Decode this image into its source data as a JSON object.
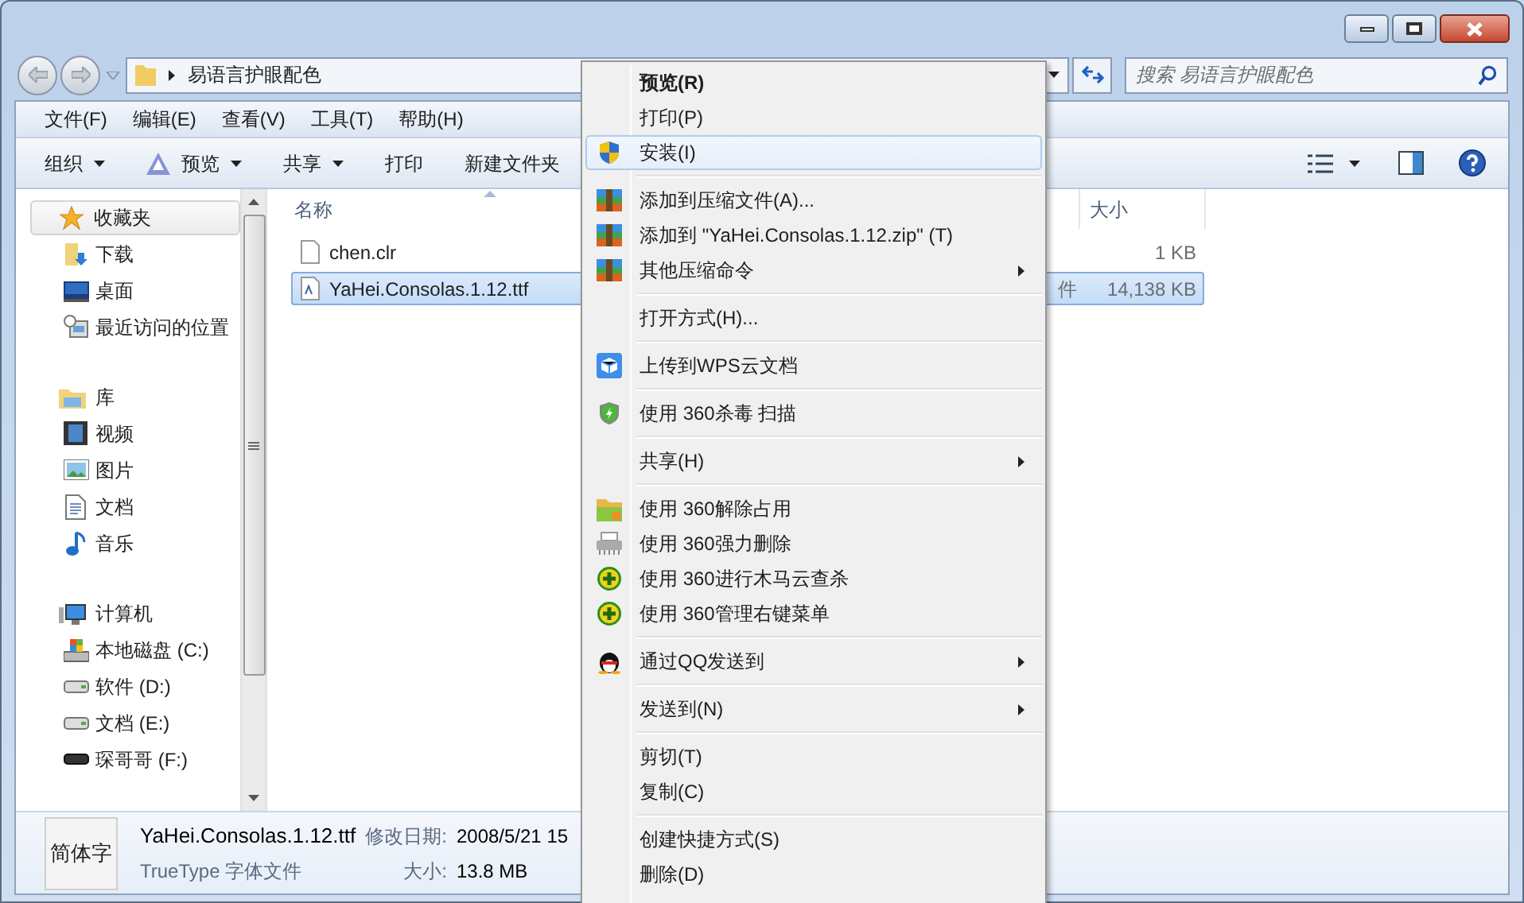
{
  "address": {
    "crumb": "易语言护眼配色"
  },
  "search": {
    "placeholder": "搜索 易语言护眼配色"
  },
  "menubar": [
    "文件(F)",
    "编辑(E)",
    "查看(V)",
    "工具(T)",
    "帮助(H)"
  ],
  "toolbar": [
    {
      "label": "组织",
      "dropdown": true,
      "icon": false
    },
    {
      "label": "预览",
      "dropdown": true,
      "icon": true
    },
    {
      "label": "共享",
      "dropdown": true,
      "icon": false
    },
    {
      "label": "打印",
      "dropdown": false,
      "icon": false
    },
    {
      "label": "新建文件夹",
      "dropdown": false,
      "icon": false
    }
  ],
  "sidebar": {
    "groups": [
      {
        "label": "收藏夹",
        "kind": "star",
        "selected": true,
        "children": [
          {
            "label": "下载",
            "kind": "download"
          },
          {
            "label": "桌面",
            "kind": "desktop"
          },
          {
            "label": "最近访问的位置",
            "kind": "recent"
          }
        ]
      },
      {
        "label": "库",
        "kind": "library",
        "selected": false,
        "children": [
          {
            "label": "视频",
            "kind": "video"
          },
          {
            "label": "图片",
            "kind": "image"
          },
          {
            "label": "文档",
            "kind": "doc"
          },
          {
            "label": "音乐",
            "kind": "music"
          }
        ]
      },
      {
        "label": "计算机",
        "kind": "computer",
        "selected": false,
        "children": [
          {
            "label": "本地磁盘 (C:)",
            "kind": "sysdrive"
          },
          {
            "label": "软件 (D:)",
            "kind": "drive"
          },
          {
            "label": "文档 (E:)",
            "kind": "drive"
          },
          {
            "label": "琛哥哥 (F:)",
            "kind": "removable"
          }
        ]
      }
    ]
  },
  "table": {
    "columns": [
      "名称",
      "大小"
    ],
    "rows": [
      {
        "name": "chen.clr",
        "size": "1 KB",
        "selected": false,
        "kind": "file"
      },
      {
        "name": "YaHei.Consolas.1.12.ttf",
        "type": "件",
        "size": "14,138 KB",
        "selected": true,
        "kind": "font"
      }
    ]
  },
  "details": {
    "thumb_text": "简体字",
    "name": "YaHei.Consolas.1.12.ttf",
    "type": "TrueType 字体文件",
    "date_label": "修改日期:",
    "date": "2008/5/21 15",
    "size_label": "大小:",
    "size": "13.8 MB"
  },
  "context_menu": {
    "groups": [
      [
        {
          "label": "预览(R)",
          "default": true,
          "selected": false,
          "submenu": false
        },
        {
          "label": "打印(P)",
          "default": false,
          "selected": false,
          "submenu": false
        },
        {
          "label": "安装(I)",
          "kind": "shield",
          "default": false,
          "selected": true,
          "submenu": false
        }
      ],
      [
        {
          "label": "添加到压缩文件(A)...",
          "kind": "archive",
          "default": false,
          "selected": false,
          "submenu": false
        },
        {
          "label": "添加到 \"YaHei.Consolas.1.12.zip\" (T)",
          "kind": "archive",
          "default": false,
          "selected": false,
          "submenu": false
        },
        {
          "label": "其他压缩命令",
          "kind": "archive",
          "default": false,
          "selected": false,
          "submenu": true
        }
      ],
      [
        {
          "label": "打开方式(H)...",
          "default": false,
          "selected": false,
          "submenu": false
        }
      ],
      [
        {
          "label": "上传到WPS云文档",
          "kind": "cube",
          "default": false,
          "selected": false,
          "submenu": false
        }
      ],
      [
        {
          "label": "使用 360杀毒 扫描",
          "kind": "greenshield",
          "default": false,
          "selected": false,
          "submenu": false
        }
      ],
      [
        {
          "label": "共享(H)",
          "default": false,
          "selected": false,
          "submenu": true
        }
      ],
      [
        {
          "label": "使用 360解除占用",
          "kind": "folder",
          "default": false,
          "selected": false,
          "submenu": false
        },
        {
          "label": "使用 360强力删除",
          "kind": "shredder",
          "default": false,
          "selected": false,
          "submenu": false
        },
        {
          "label": "使用 360进行木马云查杀",
          "kind": "plus",
          "default": false,
          "selected": false,
          "submenu": false
        },
        {
          "label": "使用 360管理右键菜单",
          "kind": "plus",
          "default": false,
          "selected": false,
          "submenu": false
        }
      ],
      [
        {
          "label": "通过QQ发送到",
          "kind": "penguin",
          "default": false,
          "selected": false,
          "submenu": true
        }
      ],
      [
        {
          "label": "发送到(N)",
          "default": false,
          "selected": false,
          "submenu": true
        }
      ],
      [
        {
          "label": "剪切(T)",
          "default": false,
          "selected": false,
          "submenu": false
        },
        {
          "label": "复制(C)",
          "default": false,
          "selected": false,
          "submenu": false
        }
      ],
      [
        {
          "label": "创建快捷方式(S)",
          "default": false,
          "selected": false,
          "submenu": false
        },
        {
          "label": "删除(D)",
          "default": false,
          "selected": false,
          "submenu": false
        }
      ]
    ]
  }
}
